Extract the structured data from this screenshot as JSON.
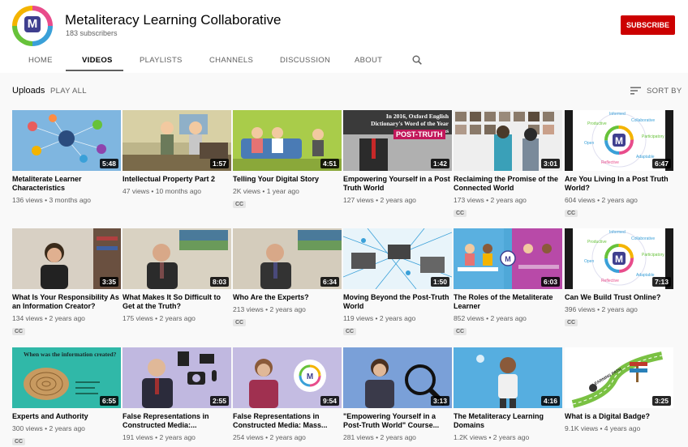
{
  "channel": {
    "name": "Metaliteracy Learning Collaborative",
    "subscribers": "183 subscribers",
    "subscribe_label": "SUBSCRIBE",
    "avatar_letter": "M"
  },
  "tabs": [
    {
      "label": "HOME",
      "active": false
    },
    {
      "label": "VIDEOS",
      "active": true
    },
    {
      "label": "PLAYLISTS",
      "active": false
    },
    {
      "label": "CHANNELS",
      "active": false
    },
    {
      "label": "DISCUSSION",
      "active": false
    },
    {
      "label": "ABOUT",
      "active": false
    }
  ],
  "section": {
    "title": "Uploads",
    "play_all": "PLAY ALL",
    "sort_label": "SORT BY"
  },
  "videos": [
    {
      "title": "Metaliterate Learner Characteristics",
      "meta": "136 views • 3 months ago",
      "duration": "5:48",
      "cc": false,
      "thumb": "network"
    },
    {
      "title": "Intellectual Property Part 2",
      "meta": "47 views • 10 months ago",
      "duration": "1:57",
      "cc": false,
      "thumb": "cartoon-office"
    },
    {
      "title": "Telling Your Digital Story",
      "meta": "2K views • 1 year ago",
      "duration": "4:51",
      "cc": true,
      "thumb": "couch"
    },
    {
      "title": "Empowering Yourself in a Post Truth World",
      "meta": "127 views • 2 years ago",
      "duration": "1:42",
      "cc": false,
      "thumb": "post-truth"
    },
    {
      "title": "Reclaiming the Promise of the Connected World",
      "meta": "173 views • 2 years ago",
      "duration": "3:01",
      "cc": true,
      "thumb": "photo-wall"
    },
    {
      "title": "Are You Living In a Post Truth World?",
      "meta": "604 views • 2 years ago",
      "duration": "6:47",
      "cc": true,
      "thumb": "logo-wheel"
    },
    {
      "title": "What Is Your Responsibility As an Information Creator?",
      "meta": "134 views • 2 years ago",
      "duration": "3:35",
      "cc": true,
      "thumb": "woman-room"
    },
    {
      "title": "What Makes It So Difficult to Get at the Truth?",
      "meta": "175 views • 2 years ago",
      "duration": "8:03",
      "cc": false,
      "thumb": "man-suit"
    },
    {
      "title": "Who Are the Experts?",
      "meta": "213 views • 2 years ago",
      "duration": "6:34",
      "cc": true,
      "thumb": "man-suit-2"
    },
    {
      "title": "Moving Beyond the Post-Truth World",
      "meta": "119 views • 2 years ago",
      "duration": "1:50",
      "cc": true,
      "thumb": "laptops"
    },
    {
      "title": "The Roles of the Metaliterate Learner",
      "meta": "852 views • 2 years ago",
      "duration": "6:03",
      "cc": true,
      "thumb": "classroom"
    },
    {
      "title": "Can We Build Trust Online?",
      "meta": "396 views • 2 years ago",
      "duration": "7:13",
      "cc": true,
      "thumb": "logo-wheel"
    },
    {
      "title": "Experts and Authority",
      "meta": "300 views • 2 years ago",
      "duration": "6:55",
      "cc": true,
      "thumb": "tree-rings",
      "thumb_caption": "When was the information created?"
    },
    {
      "title": "False Representations in Constructed Media:...",
      "meta": "191 views • 2 years ago",
      "duration": "2:55",
      "cc": false,
      "thumb": "man-icons"
    },
    {
      "title": "False Representations in Constructed Media: Mass...",
      "meta": "254 views • 2 years ago",
      "duration": "9:54",
      "cc": false,
      "thumb": "woman-logo"
    },
    {
      "title": "\"Empowering Yourself in a Post-Truth World\" Course...",
      "meta": "281 views • 2 years ago",
      "duration": "3:13",
      "cc": false,
      "thumb": "magnifier"
    },
    {
      "title": "The Metaliteracy Learning Domains",
      "meta": "1.2K views • 2 years ago",
      "duration": "4:16",
      "cc": false,
      "thumb": "cartoon-person"
    },
    {
      "title": "What is a Digital Badge?",
      "meta": "9.1K views • 4 years ago",
      "duration": "3:25",
      "cc": false,
      "thumb": "learning-path",
      "thumb_caption": "LEARNING PATH"
    }
  ],
  "thumb_text": {
    "post_truth_caption": "In 2016, Oxford English Dictionary's Word of the Year was",
    "post_truth_word": "POST-TRUTH",
    "wheel_words": [
      "Informed",
      "Collaborative",
      "Participatory",
      "Adaptable",
      "Reflective",
      "Open",
      "Productive"
    ]
  },
  "colors": {
    "subscribe": "#cc0000",
    "brand_m": "#3f3f8f",
    "text_primary": "#030303",
    "text_secondary": "#606060",
    "background": "#f9f9f9"
  },
  "icons": [
    "search-icon",
    "sort-icon"
  ]
}
